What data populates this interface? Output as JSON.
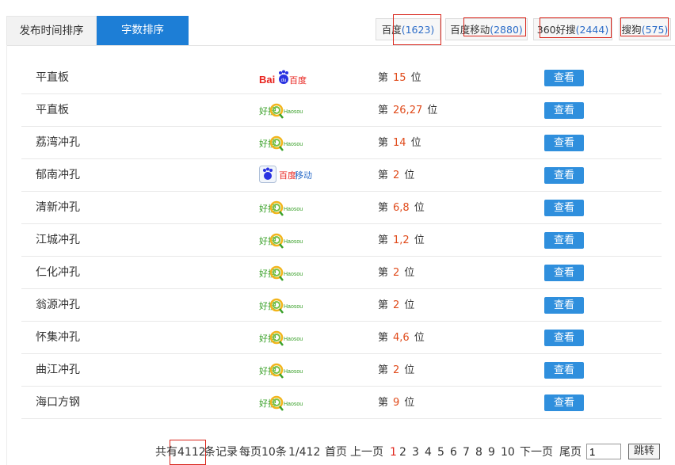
{
  "tabs": [
    {
      "label": "发布时间排序"
    },
    {
      "label": "字数排序"
    }
  ],
  "engines": [
    {
      "name": "百度",
      "count": "(1623)"
    },
    {
      "name": "百度移动",
      "count": "(2880)"
    },
    {
      "name": "360好搜",
      "count": "(2444)"
    },
    {
      "name": "搜狗",
      "count": "(575)"
    }
  ],
  "rank_prefix": "第",
  "rank_suffix": "位",
  "view_label": "查看",
  "rows": [
    {
      "keyword": "平直板",
      "engine": "baidu",
      "rank": "15"
    },
    {
      "keyword": "平直板",
      "engine": "haosou",
      "rank": "26,27"
    },
    {
      "keyword": "荔湾冲孔",
      "engine": "haosou",
      "rank": "14"
    },
    {
      "keyword": "郁南冲孔",
      "engine": "baidu-mobile",
      "rank": "2"
    },
    {
      "keyword": "清新冲孔",
      "engine": "haosou",
      "rank": "6,8"
    },
    {
      "keyword": "江城冲孔",
      "engine": "haosou",
      "rank": "1,2"
    },
    {
      "keyword": "仁化冲孔",
      "engine": "haosou",
      "rank": "2"
    },
    {
      "keyword": "翁源冲孔",
      "engine": "haosou",
      "rank": "2"
    },
    {
      "keyword": "怀集冲孔",
      "engine": "haosou",
      "rank": "4,6"
    },
    {
      "keyword": "曲江冲孔",
      "engine": "haosou",
      "rank": "2"
    },
    {
      "keyword": "海口方钢",
      "engine": "haosou",
      "rank": "9"
    }
  ],
  "logos": {
    "baidu": {
      "bai": "Bai",
      "du": "du",
      "cn": "百度"
    },
    "haosou": {
      "cn": "好搜",
      "en": "Haosou"
    },
    "baidu_mobile": {
      "cn1": "百度",
      "cn2": "移动"
    }
  },
  "pager": {
    "total_prefix": "共有",
    "total": "4112",
    "total_suffix": "条记录",
    "per_page": "每页10条",
    "position": "1/412",
    "first": "首页",
    "prev": "上一页",
    "pages": [
      "1",
      "2",
      "3",
      "4",
      "5",
      "6",
      "7",
      "8",
      "9",
      "10"
    ],
    "next": "下一页",
    "last": "尾页",
    "input_value": "1",
    "jump": "跳转"
  },
  "colors": {
    "accent": "#1d7ed6",
    "button": "#2f8fdd",
    "rank_number": "#e04a1a",
    "highlight_box": "#d9261c"
  }
}
